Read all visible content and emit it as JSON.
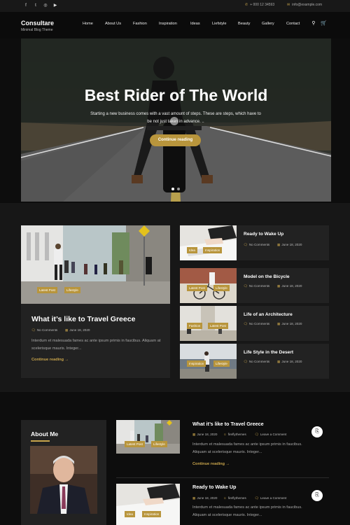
{
  "topbar": {
    "social_icons": [
      "facebook-icon",
      "twitter-icon",
      "instagram-icon",
      "youtube-icon"
    ],
    "social_glyphs": [
      "f",
      "t",
      "◎",
      "▶"
    ],
    "phone": "+ 000 12 34593",
    "email": "info@example.com"
  },
  "header": {
    "site_title": "Consultare",
    "tagline": "Minimal Blog Theme",
    "nav": [
      "Home",
      "About Us",
      "Fashion",
      "Inspiration",
      "Ideas",
      "Liefstyle",
      "Beauty",
      "Gallery",
      "Contact"
    ],
    "search_glyph": "⚲",
    "cart_glyph": "🛒"
  },
  "hero": {
    "title": "Best Rider of The World",
    "text": "Starting a new business comes with a vast amount of steps. These are steps, which have to be not just taken in advance. ..",
    "button": "Continue reading",
    "active_slide": 1,
    "slides": 2
  },
  "featured": {
    "title": "What it’s like to Travel Greece",
    "tags": [
      "Latest Post",
      "Lifestyle"
    ],
    "comments": "No Comments",
    "date": "June 18, 2020",
    "excerpt": "Interdum et malesuada fames ac ante ipsum primis in faucibus. Aliquam at scelerisque mauris. Integer...",
    "continue": "Continue reading →"
  },
  "side_posts": [
    {
      "title": "Ready to Wake Up",
      "tags": [
        "Idea",
        "Inspiration"
      ],
      "comments": "No Comments",
      "date": "June 18, 2020"
    },
    {
      "title": "Model on the Bicycle",
      "tags": [
        "Latest Post",
        "Lifestyle"
      ],
      "comments": "No Comments",
      "date": "June 18, 2020"
    },
    {
      "title": "Life of an Architecture",
      "tags": [
        "Fashion",
        "Latest Post"
      ],
      "comments": "No Comments",
      "date": "June 18, 2020"
    },
    {
      "title": "Life Style in the Desert",
      "tags": [
        "Inspiration",
        "Lifestyle"
      ],
      "comments": "No Comments",
      "date": "June 18, 2020"
    }
  ],
  "about": {
    "title": "About Me"
  },
  "posts": [
    {
      "title": "What it’s like to Travel Greece",
      "tags": [
        "Latest Post",
        "Lifestyle"
      ],
      "date": "June 18, 2020",
      "author": "fireflythemes",
      "comments": "Leave a Comment",
      "excerpt": "Interdum et malesuada fames ac ante ipsum primis in faucibus. Aliquam at scelerisque mauris. Integer...",
      "continue": "Continue reading →"
    },
    {
      "title": "Ready to Wake Up",
      "tags": [
        "Idea",
        "Inspiration"
      ],
      "date": "June 18, 2020",
      "author": "fireflythemes",
      "comments": "Leave a Comment",
      "excerpt": "Interdum et malesuada fames ac ante ipsum primis in faucibus. Aliquam at scelerisque mauris. Integer..."
    }
  ],
  "colors": {
    "accent": "#b8953c",
    "background": "#0d0d0d",
    "card": "#222222"
  }
}
